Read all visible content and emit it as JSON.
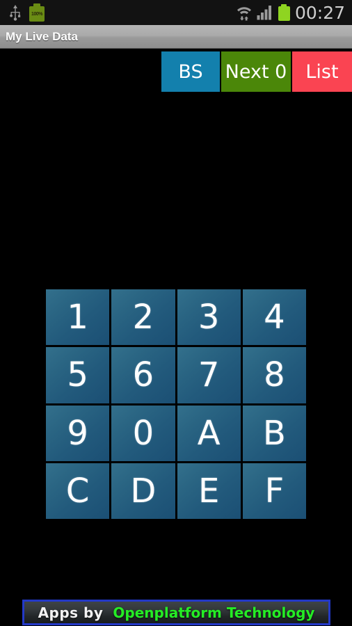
{
  "status_bar": {
    "usb_icon": "usb-icon",
    "battery_charge_icon": "battery-charging-icon",
    "battery_percent_label": "100%",
    "wifi_icon": "wifi-transfer-icon",
    "signal_icon": "cellular-signal-icon",
    "battery_icon": "battery-icon",
    "clock": "00:27"
  },
  "title_bar": {
    "title": "My Live Data"
  },
  "toolbar": {
    "buttons": [
      {
        "label": "BS",
        "name": "backspace-button",
        "color": "#1380ad"
      },
      {
        "label": "Next 0",
        "name": "next-button",
        "color": "#4b8709"
      },
      {
        "label": "List",
        "name": "list-button",
        "color": "#fa4452"
      }
    ]
  },
  "keypad": {
    "keys": [
      "1",
      "2",
      "3",
      "4",
      "5",
      "6",
      "7",
      "8",
      "9",
      "0",
      "A",
      "B",
      "C",
      "D",
      "E",
      "F"
    ],
    "key_color_light": "#33708c",
    "key_color_dark": "#1b4f74"
  },
  "ad_banner": {
    "prefix": "Apps by",
    "brand": "Openplatform Technology",
    "border_color": "#2339c8",
    "brand_color": "#25ec25"
  }
}
